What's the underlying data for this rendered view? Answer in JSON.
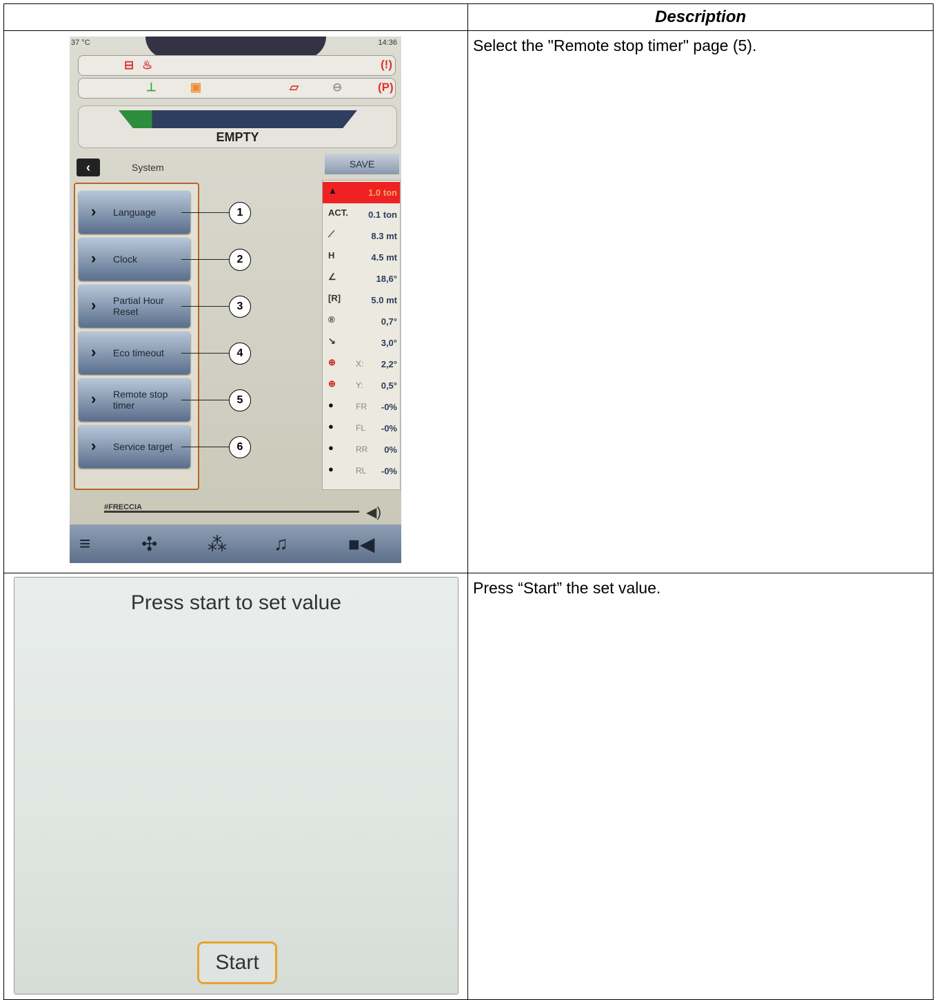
{
  "header": {
    "description_heading": "Description"
  },
  "rows": [
    {
      "description": "Select the \"Remote stop timer\" page (5)."
    },
    {
      "description": "Press “Start” the set value."
    }
  ],
  "phone": {
    "temperature": "37 °C",
    "time": "14:36",
    "load_label": "EMPTY",
    "section_title": "System",
    "save_label": "SAVE",
    "menu": [
      {
        "label": "Language",
        "callout": "1"
      },
      {
        "label": "Clock",
        "callout": "2"
      },
      {
        "label": "Partial Hour Reset",
        "callout": "3"
      },
      {
        "label": "Eco timeout",
        "callout": "4"
      },
      {
        "label": "Remote stop timer",
        "callout": "5"
      },
      {
        "label": "Service target",
        "callout": "6"
      }
    ],
    "readouts": [
      {
        "icon": "weight-icon",
        "label": "",
        "value": "1.0 ton"
      },
      {
        "icon": "act-text",
        "label": "ACT.",
        "value": "0.1 ton"
      },
      {
        "icon": "length-icon",
        "label": "",
        "value": "8.3 mt"
      },
      {
        "icon": "height-icon",
        "label": "H",
        "value": "4.5 mt"
      },
      {
        "icon": "angle-icon",
        "label": "",
        "value": "18,6°"
      },
      {
        "icon": "radius-icon",
        "label": "",
        "value": "5.0 mt"
      },
      {
        "icon": "rotation-icon",
        "label": "",
        "value": "0,7°"
      },
      {
        "icon": "slope-icon",
        "label": "",
        "value": "3,0°"
      },
      {
        "icon": "level-x-icon",
        "label": "X:",
        "value": "2,2°"
      },
      {
        "icon": "level-y-icon",
        "label": "Y:",
        "value": "0,5°"
      },
      {
        "icon": "tyre-icon",
        "label": "FR",
        "value": "-0%"
      },
      {
        "icon": "tyre-icon",
        "label": "FL",
        "value": "-0%"
      },
      {
        "icon": "tyre-icon",
        "label": "RR",
        "value": "0%"
      },
      {
        "icon": "tyre-icon",
        "label": "RL",
        "value": "-0%"
      }
    ],
    "radio_station": "#FRECCIA"
  },
  "screen2": {
    "message": "Press start to set value",
    "start_label": "Start"
  },
  "colors": {
    "menu_border": "#b7652a",
    "start_border": "#e8a32a",
    "alert_red": "#dd3333"
  }
}
